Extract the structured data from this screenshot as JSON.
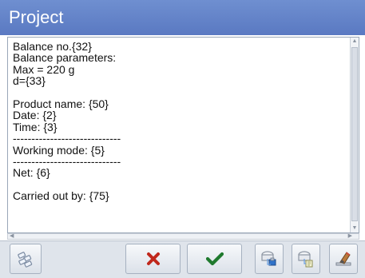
{
  "window": {
    "title": "Project"
  },
  "editor": {
    "lines": [
      "Balance no.{32}",
      "Balance parameters:",
      "Max = 220 g",
      "d={33}",
      "",
      "Product name: {50}",
      "Date: {2}",
      "Time: {3}",
      "-----------------------------",
      "Working mode: {5}",
      "-----------------------------",
      "Net: {6}",
      "",
      "Carried out by: {75}"
    ]
  },
  "toolbar": {
    "buttons": [
      {
        "icon": "variables-icon"
      },
      {
        "icon": "cancel-icon",
        "color": "#c0281c"
      },
      {
        "icon": "accept-icon",
        "color": "#1f7a2e"
      },
      {
        "icon": "export-to-usb-icon"
      },
      {
        "icon": "import-from-usb-icon"
      },
      {
        "icon": "clear-icon"
      }
    ]
  },
  "colors": {
    "titlebar": "#5f7fc6",
    "toolbar": "#dfe4eb"
  }
}
